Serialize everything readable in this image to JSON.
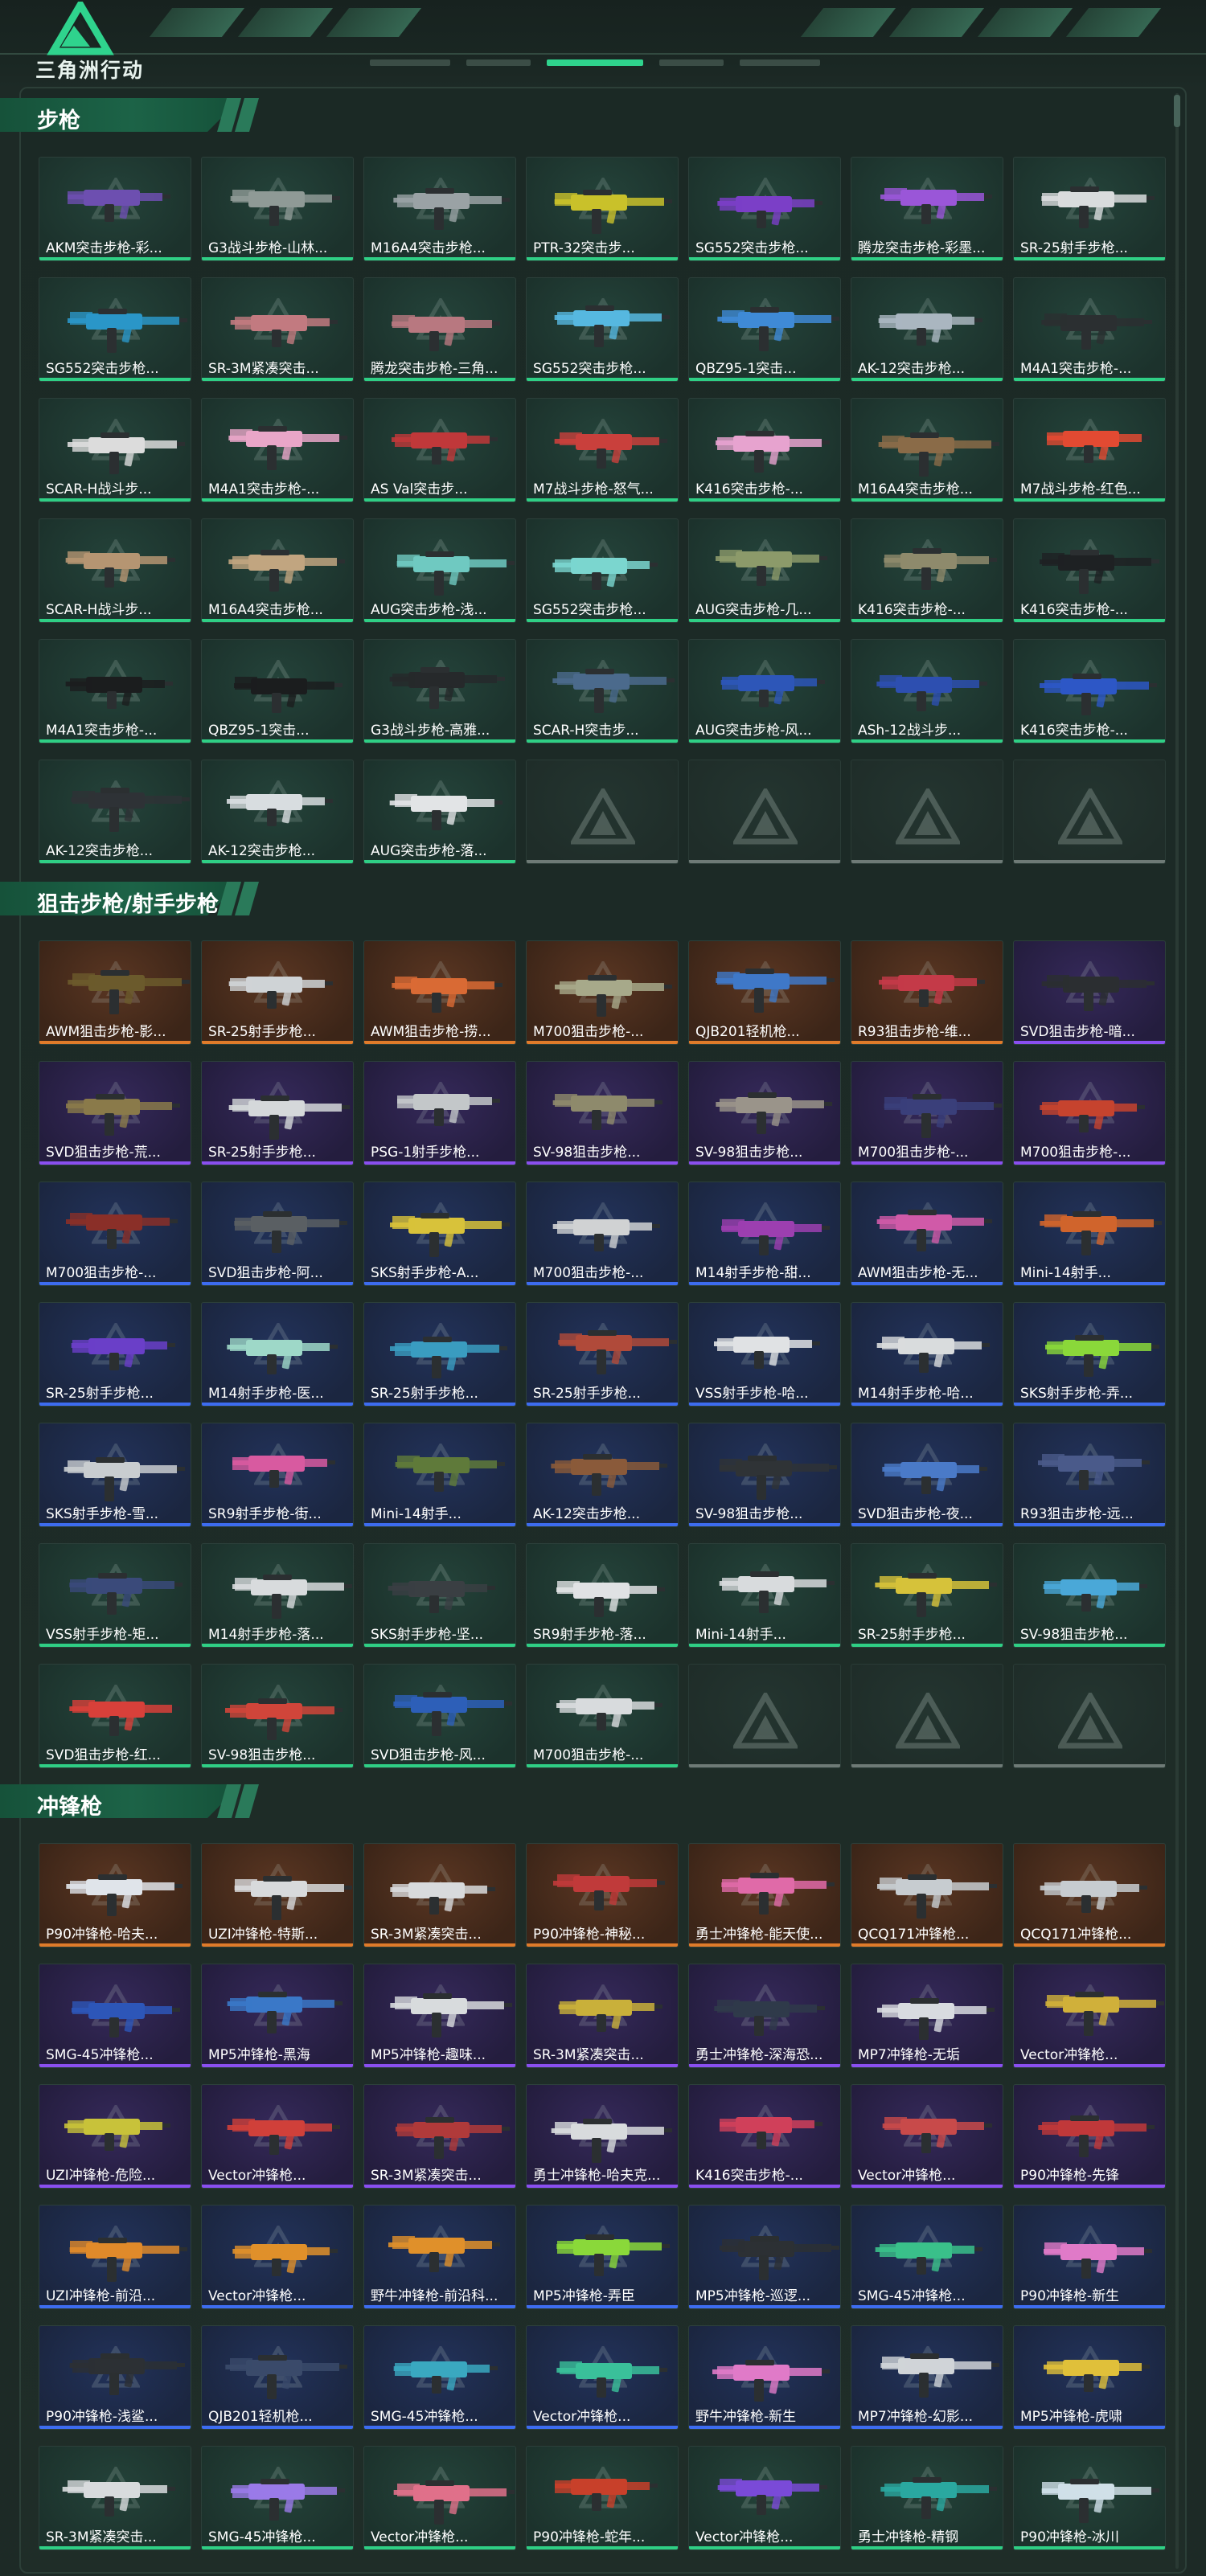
{
  "header": {
    "logo_text": "三角洲行动",
    "logo_icon": "triangle-logo-icon"
  },
  "colors": {
    "green_rarity": "#2fcf85",
    "white_rarity": "#c9cfd0",
    "blue_rarity": "#3d6cf0",
    "purple_rarity": "#8a4ff0",
    "orange_rarity": "#e07b2a",
    "accent": "#2fd38d"
  },
  "sections": [
    {
      "title": "步枪",
      "items": [
        {
          "name": "AKM突击步枪-彩...",
          "rarity": "green",
          "gun": "#6d4fb0"
        },
        {
          "name": "G3战斗步枪-山林...",
          "rarity": "green",
          "gun": "#8f9a96"
        },
        {
          "name": "M16A4突击步枪...",
          "rarity": "green",
          "gun": "#9aa2a5"
        },
        {
          "name": "PTR-32突击步...",
          "rarity": "green",
          "gun": "#c9c12a"
        },
        {
          "name": "SG552突击步枪...",
          "rarity": "green",
          "gun": "#7b3fc7"
        },
        {
          "name": "腾龙突击步枪-彩墨...",
          "rarity": "green",
          "gun": "#9a56d8"
        },
        {
          "name": "SR-25射手步枪...",
          "rarity": "green",
          "gun": "#d9dcdd"
        },
        {
          "name": "SG552突击步枪...",
          "rarity": "green",
          "gun": "#2a96c8"
        },
        {
          "name": "SR-3M紧凑突击...",
          "rarity": "green",
          "gun": "#c27a80"
        },
        {
          "name": "腾龙突击步枪-三角...",
          "rarity": "green",
          "gun": "#b87880"
        },
        {
          "name": "SG552突击步枪...",
          "rarity": "green",
          "gun": "#56b8e0"
        },
        {
          "name": "QBZ95-1突击...",
          "rarity": "green",
          "gun": "#3f8ad6"
        },
        {
          "name": "AK-12突击步枪...",
          "rarity": "green",
          "gun": "#aab6c0"
        },
        {
          "name": "M4A1突击步枪-...",
          "rarity": "green",
          "gun": "#2b2f31"
        },
        {
          "name": "SCAR-H战斗步...",
          "rarity": "green",
          "gun": "#dcdcdc"
        },
        {
          "name": "M4A1突击步枪-...",
          "rarity": "green",
          "gun": "#e9a6c8"
        },
        {
          "name": "AS Val突击步...",
          "rarity": "green",
          "gun": "#c0383a"
        },
        {
          "name": "M7战斗步枪-怒气...",
          "rarity": "green",
          "gun": "#c9403c"
        },
        {
          "name": "K416突击步枪-...",
          "rarity": "green",
          "gun": "#e7a3cf"
        },
        {
          "name": "M16A4突击步枪...",
          "rarity": "green",
          "gun": "#8a6b48"
        },
        {
          "name": "M7战斗步枪-红色...",
          "rarity": "green",
          "gun": "#e24a32"
        },
        {
          "name": "SCAR-H战斗步...",
          "rarity": "green",
          "gun": "#b59572"
        },
        {
          "name": "M16A4突击步枪...",
          "rarity": "green",
          "gun": "#c1a580"
        },
        {
          "name": "AUG突击步枪-浅...",
          "rarity": "green",
          "gun": "#6fc9c1"
        },
        {
          "name": "SG552突击步枪...",
          "rarity": "green",
          "gun": "#7bd6cf"
        },
        {
          "name": "AUG突击步枪-几...",
          "rarity": "green",
          "gun": "#8c9a6a"
        },
        {
          "name": "K416突击步枪-...",
          "rarity": "green",
          "gun": "#8e8a6c"
        },
        {
          "name": "K416突击步枪-...",
          "rarity": "green",
          "gun": "#1e2123"
        },
        {
          "name": "M4A1突击步枪-...",
          "rarity": "green",
          "gun": "#1b1d1e"
        },
        {
          "name": "QBZ95-1突击...",
          "rarity": "green",
          "gun": "#1b1d1e"
        },
        {
          "name": "G3战斗步枪-高雅...",
          "rarity": "green",
          "gun": "#26292b"
        },
        {
          "name": "SCAR-H突击步...",
          "rarity": "green",
          "gun": "#4b6a8c"
        },
        {
          "name": "AUG突击步枪-风...",
          "rarity": "green",
          "gun": "#2d56b8"
        },
        {
          "name": "ASh-12战斗步...",
          "rarity": "green",
          "gun": "#2d4fb0"
        },
        {
          "name": "K416突击步枪-...",
          "rarity": "green",
          "gun": "#2d57c6"
        },
        {
          "name": "AK-12突击步枪...",
          "rarity": "green",
          "gun": "#2e3236"
        },
        {
          "name": "AK-12突击步枪...",
          "rarity": "green",
          "gun": "#d8dde0"
        },
        {
          "name": "AUG突击步枪-落...",
          "rarity": "green",
          "gun": "#e2e4e6"
        },
        {
          "name": "",
          "rarity": "empty",
          "gun": ""
        },
        {
          "name": "",
          "rarity": "empty",
          "gun": ""
        },
        {
          "name": "",
          "rarity": "empty",
          "gun": ""
        },
        {
          "name": "",
          "rarity": "empty",
          "gun": ""
        }
      ]
    },
    {
      "title": "狙击步枪/射手步枪",
      "items": [
        {
          "name": "AWM狙击步枪-影...",
          "rarity": "orange",
          "gun": "#6b5a2c"
        },
        {
          "name": "SR-25射手步枪...",
          "rarity": "orange",
          "gun": "#cfd3d6"
        },
        {
          "name": "AWM狙击步枪-捞...",
          "rarity": "orange",
          "gun": "#d96a34"
        },
        {
          "name": "M700狙击步枪-...",
          "rarity": "orange",
          "gun": "#a7a98a"
        },
        {
          "name": "QJB201轻机枪...",
          "rarity": "orange",
          "gun": "#3f78c8"
        },
        {
          "name": "R93狙击步枪-维...",
          "rarity": "orange",
          "gun": "#c43a48"
        },
        {
          "name": "SVD狙击步枪-暗...",
          "rarity": "purple",
          "gun": "#2b2e31"
        },
        {
          "name": "SVD狙击步枪-荒...",
          "rarity": "purple",
          "gun": "#8a7a4a"
        },
        {
          "name": "SR-25射手步枪...",
          "rarity": "purple",
          "gun": "#d5d8da"
        },
        {
          "name": "PSG-1射手步枪...",
          "rarity": "purple",
          "gun": "#c3c7c9"
        },
        {
          "name": "SV-98狙击步枪...",
          "rarity": "purple",
          "gun": "#8e8a6c"
        },
        {
          "name": "SV-98狙击步枪...",
          "rarity": "purple",
          "gun": "#9a948a"
        },
        {
          "name": "M700狙击步枪-...",
          "rarity": "purple",
          "gun": "#3a3f7a"
        },
        {
          "name": "M700狙击步枪-...",
          "rarity": "purple",
          "gun": "#c6432e"
        },
        {
          "name": "M700狙击步枪-...",
          "rarity": "blue",
          "gun": "#8a2f28"
        },
        {
          "name": "SVD狙击步枪-阿...",
          "rarity": "blue",
          "gun": "#5a5f63"
        },
        {
          "name": "SKS射手步枪-A...",
          "rarity": "blue",
          "gun": "#d8c23a"
        },
        {
          "name": "M700狙击步枪-...",
          "rarity": "blue",
          "gun": "#d0d2d3"
        },
        {
          "name": "M14射手步枪-甜...",
          "rarity": "blue",
          "gun": "#9c3fb0"
        },
        {
          "name": "AWM狙击步枪-无...",
          "rarity": "blue",
          "gun": "#d05aa8"
        },
        {
          "name": "Mini-14射手...",
          "rarity": "blue",
          "gun": "#d0642c"
        },
        {
          "name": "SR-25射手步枪...",
          "rarity": "blue",
          "gun": "#6a3fc8"
        },
        {
          "name": "M14射手步枪-医...",
          "rarity": "blue",
          "gun": "#9ed8c8"
        },
        {
          "name": "SR-25射手步枪...",
          "rarity": "blue",
          "gun": "#3a9cc0"
        },
        {
          "name": "SR-25射手步枪...",
          "rarity": "blue",
          "gun": "#b04a3a"
        },
        {
          "name": "VSS射手步枪-哈...",
          "rarity": "blue",
          "gun": "#e0e2e4"
        },
        {
          "name": "M14射手步枪-哈...",
          "rarity": "blue",
          "gun": "#d9dcdd"
        },
        {
          "name": "SKS射手步枪-弄...",
          "rarity": "blue",
          "gun": "#8ad83a"
        },
        {
          "name": "SKS射手步枪-雪...",
          "rarity": "blue",
          "gun": "#c9cdd0"
        },
        {
          "name": "SR9射手步枪-街...",
          "rarity": "blue",
          "gun": "#d85aa0"
        },
        {
          "name": "Mini-14射手...",
          "rarity": "blue",
          "gun": "#5f7a3a"
        },
        {
          "name": "AK-12突击步枪...",
          "rarity": "blue",
          "gun": "#8a5a3a"
        },
        {
          "name": "SV-98狙击步枪...",
          "rarity": "blue",
          "gun": "#2f3336"
        },
        {
          "name": "SVD狙击步枪-夜...",
          "rarity": "blue",
          "gun": "#4a7ac8"
        },
        {
          "name": "R93狙击步枪-远...",
          "rarity": "blue",
          "gun": "#4a5a8a"
        },
        {
          "name": "VSS射手步枪-矩...",
          "rarity": "green",
          "gun": "#3a4a7a"
        },
        {
          "name": "M14射手步枪-落...",
          "rarity": "green",
          "gun": "#d8dbdd"
        },
        {
          "name": "SKS射手步枪-坚...",
          "rarity": "green",
          "gun": "#3a3f43"
        },
        {
          "name": "SR9射手步枪-落...",
          "rarity": "green",
          "gun": "#e0e2e4"
        },
        {
          "name": "Mini-14射手...",
          "rarity": "green",
          "gun": "#d8dbdd"
        },
        {
          "name": "SR-25射手步枪...",
          "rarity": "green",
          "gun": "#d6c23a"
        },
        {
          "name": "SV-98狙击步枪...",
          "rarity": "green",
          "gun": "#4aa8d8"
        },
        {
          "name": "SVD狙击步枪-红...",
          "rarity": "green",
          "gun": "#d8403a"
        },
        {
          "name": "SV-98狙击步枪...",
          "rarity": "green",
          "gun": "#d0453a"
        },
        {
          "name": "SVD狙击步枪-风...",
          "rarity": "green",
          "gun": "#2d5fb8"
        },
        {
          "name": "M700狙击步枪-...",
          "rarity": "green",
          "gun": "#d8dbdd"
        },
        {
          "name": "",
          "rarity": "empty",
          "gun": ""
        },
        {
          "name": "",
          "rarity": "empty",
          "gun": ""
        },
        {
          "name": "",
          "rarity": "empty",
          "gun": ""
        }
      ]
    },
    {
      "title": "冲锋枪",
      "items": [
        {
          "name": "P90冲锋枪-哈夫...",
          "rarity": "orange",
          "gun": "#e0e4ea"
        },
        {
          "name": "UZI冲锋枪-特斯...",
          "rarity": "orange",
          "gun": "#d8dadc"
        },
        {
          "name": "SR-3M紧凑突击...",
          "rarity": "orange",
          "gun": "#d8dadc"
        },
        {
          "name": "P90冲锋枪-神秘...",
          "rarity": "orange",
          "gun": "#c03a3a"
        },
        {
          "name": "勇士冲锋枪-能天使...",
          "rarity": "orange",
          "gun": "#e06aa8"
        },
        {
          "name": "QCQ171冲锋枪...",
          "rarity": "orange",
          "gun": "#c7ccd0"
        },
        {
          "name": "QCQ171冲锋枪...",
          "rarity": "orange",
          "gun": "#c7ccd0"
        },
        {
          "name": "SMG-45冲锋枪...",
          "rarity": "purple",
          "gun": "#2d56b8"
        },
        {
          "name": "MP5冲锋枪-黑海",
          "rarity": "purple",
          "gun": "#3a78c8"
        },
        {
          "name": "MP5冲锋枪-趣味...",
          "rarity": "purple",
          "gun": "#d8dbdd"
        },
        {
          "name": "SR-3M紧凑突击...",
          "rarity": "purple",
          "gun": "#c9b03a"
        },
        {
          "name": "勇士冲锋枪-深海恐...",
          "rarity": "purple",
          "gun": "#2f3a4a"
        },
        {
          "name": "MP7冲锋枪-无垢",
          "rarity": "purple",
          "gun": "#d8dbe0"
        },
        {
          "name": "Vector冲锋枪...",
          "rarity": "purple",
          "gun": "#d0b03a"
        },
        {
          "name": "UZI冲锋枪-危险...",
          "rarity": "purple",
          "gun": "#c8c23a"
        },
        {
          "name": "Vector冲锋枪...",
          "rarity": "purple",
          "gun": "#d0403a"
        },
        {
          "name": "SR-3M紧凑突击...",
          "rarity": "purple",
          "gun": "#b03a3a"
        },
        {
          "name": "勇士冲锋枪-哈夫克...",
          "rarity": "purple",
          "gun": "#d8dbdd"
        },
        {
          "name": "K416突击步枪-...",
          "rarity": "purple",
          "gun": "#d0405a"
        },
        {
          "name": "Vector冲锋枪...",
          "rarity": "purple",
          "gun": "#c84a4a"
        },
        {
          "name": "P90冲锋枪-先锋",
          "rarity": "purple",
          "gun": "#c0383a"
        },
        {
          "name": "UZI冲锋枪-前沿...",
          "rarity": "blue",
          "gun": "#e08a2a"
        },
        {
          "name": "Vector冲锋枪...",
          "rarity": "blue",
          "gun": "#e0902a"
        },
        {
          "name": "野牛冲锋枪-前沿科...",
          "rarity": "blue",
          "gun": "#e0902a"
        },
        {
          "name": "MP5冲锋枪-弄臣",
          "rarity": "blue",
          "gun": "#8ad83a"
        },
        {
          "name": "MP5冲锋枪-巡逻...",
          "rarity": "blue",
          "gun": "#2c3034"
        },
        {
          "name": "SMG-45冲锋枪...",
          "rarity": "blue",
          "gun": "#3ac08a"
        },
        {
          "name": "P90冲锋枪-新生",
          "rarity": "blue",
          "gun": "#e07ac8"
        },
        {
          "name": "P90冲锋枪-浅鲨...",
          "rarity": "blue",
          "gun": "#2c3034"
        },
        {
          "name": "QJB201轻机枪...",
          "rarity": "blue",
          "gun": "#3a4a6a"
        },
        {
          "name": "SMG-45冲锋枪...",
          "rarity": "blue",
          "gun": "#3aa8c0"
        },
        {
          "name": "Vector冲锋枪...",
          "rarity": "blue",
          "gun": "#3ac09a"
        },
        {
          "name": "野牛冲锋枪-新生",
          "rarity": "blue",
          "gun": "#e07ac8"
        },
        {
          "name": "MP7冲锋枪-幻影...",
          "rarity": "blue",
          "gun": "#d0d4d8"
        },
        {
          "name": "MP5冲锋枪-虎啸",
          "rarity": "blue",
          "gun": "#e0c03a"
        },
        {
          "name": "SR-3M紧凑突击...",
          "rarity": "green",
          "gun": "#d8dbdd"
        },
        {
          "name": "SMG-45冲锋枪...",
          "rarity": "green",
          "gun": "#9a7ae8"
        },
        {
          "name": "Vector冲锋枪...",
          "rarity": "green",
          "gun": "#e0708a"
        },
        {
          "name": "P90冲锋枪-蛇年...",
          "rarity": "green",
          "gun": "#c8402a"
        },
        {
          "name": "Vector冲锋枪...",
          "rarity": "green",
          "gun": "#7a4ad8"
        },
        {
          "name": "勇士冲锋枪-精钢",
          "rarity": "green",
          "gun": "#2aa8a0"
        },
        {
          "name": "P90冲锋枪-冰川",
          "rarity": "green",
          "gun": "#d0e0e8"
        }
      ]
    }
  ]
}
